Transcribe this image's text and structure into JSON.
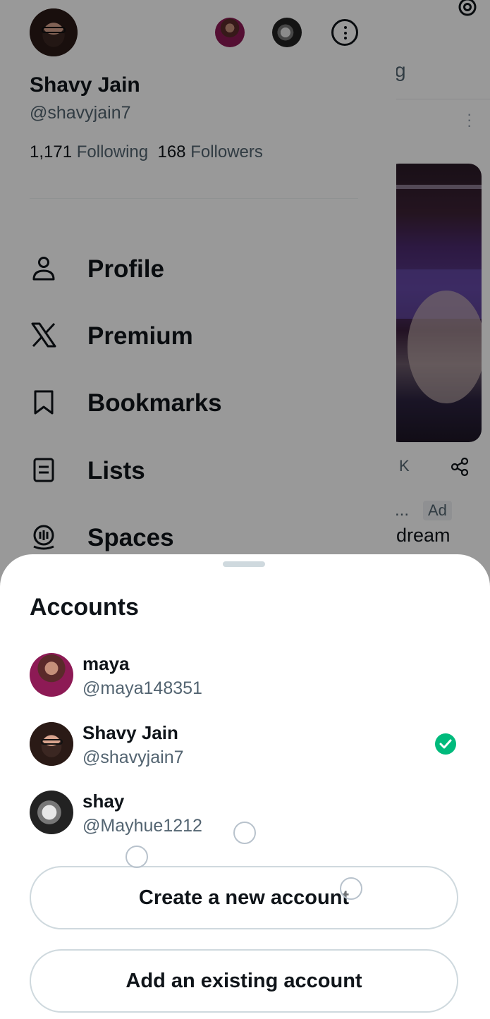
{
  "profile": {
    "name": "Shavy Jain",
    "handle": "@shavyjain7",
    "following_count": "1,171",
    "following_label": "Following",
    "followers_count": "168",
    "followers_label": "Followers"
  },
  "nav": [
    {
      "label": "Profile",
      "icon": "person-icon"
    },
    {
      "label": "Premium",
      "icon": "x-logo-icon"
    },
    {
      "label": "Bookmarks",
      "icon": "bookmark-icon"
    },
    {
      "label": "Lists",
      "icon": "list-icon"
    },
    {
      "label": "Spaces",
      "icon": "spaces-icon"
    }
  ],
  "background_feed": {
    "tab_fragment": "g",
    "stat_fragment": "K",
    "ad_prefix": "...",
    "ad_badge": "Ad",
    "text_fragment": "dream"
  },
  "accounts_sheet": {
    "title": "Accounts",
    "accounts": [
      {
        "name": "maya",
        "handle": "@maya148351",
        "active": false
      },
      {
        "name": "Shavy Jain",
        "handle": "@shavyjain7",
        "active": true
      },
      {
        "name": "shay",
        "handle": "@Mayhue1212",
        "active": false
      }
    ],
    "create_label": "Create a new account",
    "add_label": "Add an existing account"
  },
  "colors": {
    "active_check": "#00ba7c",
    "secondary_text": "#536471",
    "primary_text": "#0f1419"
  }
}
